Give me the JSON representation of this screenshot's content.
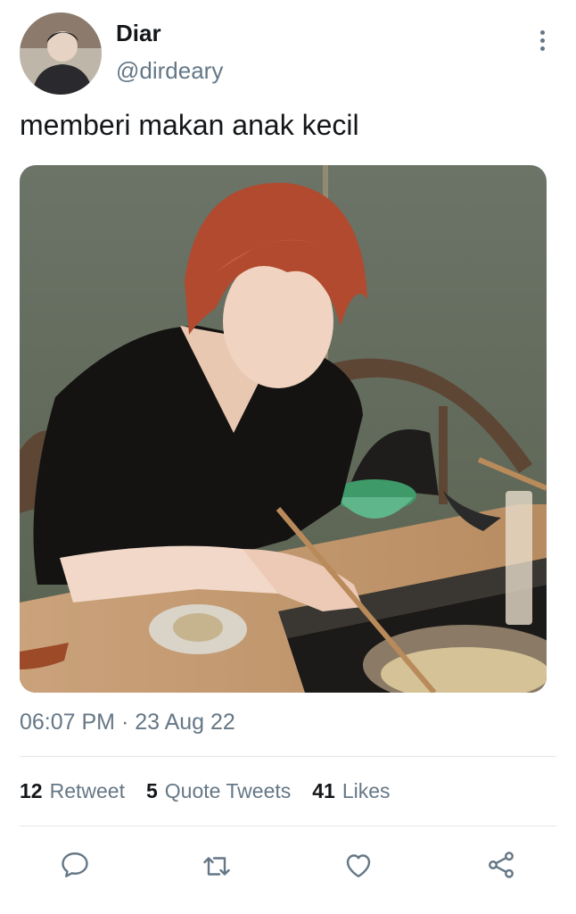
{
  "user": {
    "display_name": "Diar",
    "handle": "@dirdeary"
  },
  "tweet": {
    "text": "memberi makan anak kecil",
    "timestamp": "06:07 PM · 23 Aug 22"
  },
  "stats": {
    "retweets_count": "12",
    "retweets_label": "Retweet",
    "quotes_count": "5",
    "quotes_label": "Quote Tweets",
    "likes_count": "41",
    "likes_label": "Likes"
  },
  "icons": {
    "more": "more-vertical-icon",
    "reply": "reply-icon",
    "retweet": "retweet-icon",
    "like": "heart-icon",
    "share": "share-icon"
  },
  "colors": {
    "secondary_text": "#657786",
    "primary_text": "#14171a",
    "divider": "#e1e8ed"
  }
}
